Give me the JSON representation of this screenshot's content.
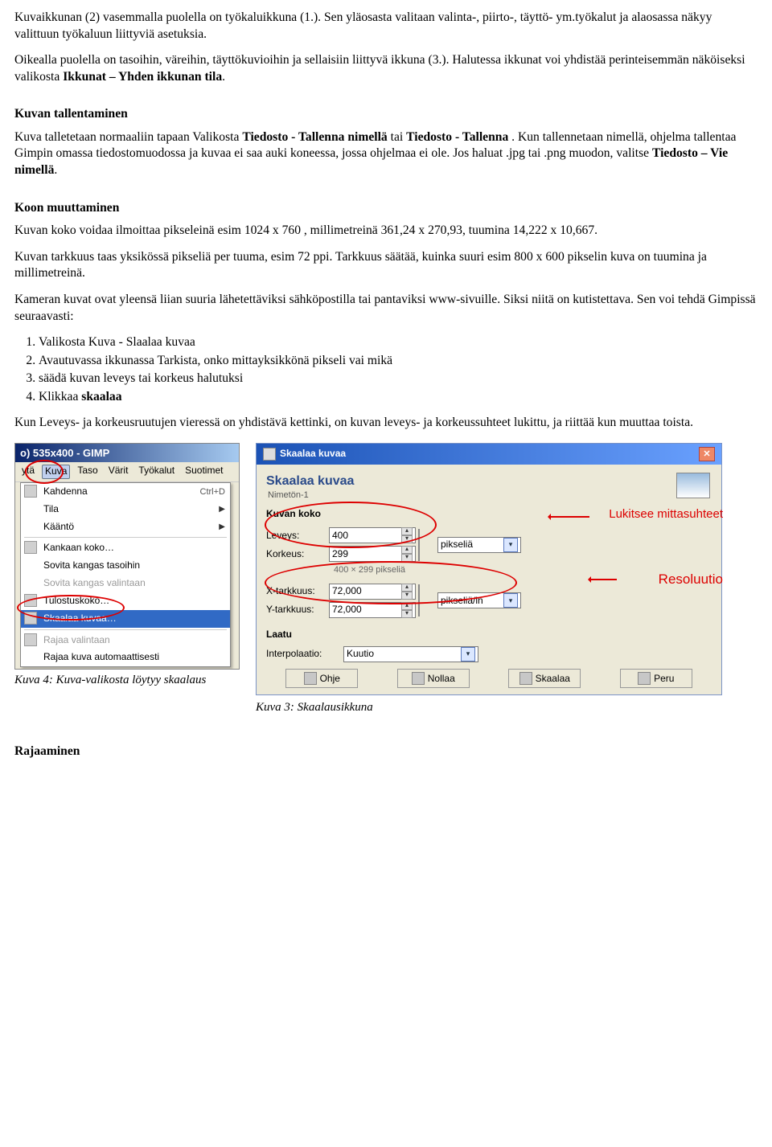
{
  "p1a": "Kuvaikkunan (2) vasemmalla puolella on työkaluikkuna (1.). Sen yläosasta valitaan valinta-, piirto-, täyttö- ym.työkalut ja alaosassa näkyy valittuun työkaluun liittyviä asetuksia.",
  "p1b_pre": "Oikealla puolella on tasoihin, väreihin, täyttökuvioihin ja sellaisiin liittyvä ikkuna (3.). Halutessa ikkunat voi yhdistää perinteisemmän näköiseksi valikosta ",
  "p1b_strong": "Ikkunat – Yhden ikkunan tila",
  "s1_title": "Kuvan tallentaminen",
  "s1_p1_a": "Kuva talletetaan normaaliin tapaan Valikosta ",
  "s1_p1_b": "Tiedosto - Tallenna nimellä",
  "s1_p1_c": "  tai ",
  "s1_p1_d": "Tiedosto - Tallenna",
  "s1_p1_e": ". Kun tallennetaan nimellä, ohjelma tallentaa Gimpin omassa tiedostomuodossa ja kuvaa ei saa auki koneessa, jossa ohjelmaa ei ole. Jos haluat .jpg tai .png muodon, valitse ",
  "s1_p1_f": "Tiedosto – Vie nimellä",
  "s2_title": "Koon muuttaminen",
  "s2_p1": "Kuvan koko voidaa ilmoittaa pikseleinä esim 1024 x 760 , millimetreinä 361,24 x 270,93, tuumina 14,222 x 10,667.",
  "s2_p2": "Kuvan tarkkuus taas yksikössä pikseliä per tuuma, esim 72 ppi. Tarkkuus säätää, kuinka suuri esim 800 x 600 pikselin kuva on tuumina ja millimetreinä.",
  "s2_p3": "Kameran kuvat ovat yleensä liian suuria lähetettäviksi sähköpostilla tai pantaviksi www-sivuille. Siksi niitä on kutistettava. Sen voi tehdä Gimpissä seuraavasti:",
  "ol": {
    "i1": "Valikosta Kuva - Slaalaa kuvaa",
    "i2": "Avautuvassa ikkunassa Tarkista, onko mittayksikkönä pikseli vai mikä",
    "i3": "säädä kuvan leveys tai korkeus halutuksi",
    "i4_a": "Klikkaa ",
    "i4_b": "skaalaa"
  },
  "s2_p4": "Kun Leveys- ja korkeusruutujen vieressä on yhdistävä kettinki, on kuvan leveys- ja korkeussuhteet lukittu, ja riittää kun muuttaa toista.",
  "fig_left_caption": "Kuva 4: Kuva-valikosta löytyy skaalaus",
  "fig_right_caption": "Kuva 3: Skaalausikkuna",
  "gimp": {
    "title": "o) 535x400 - GIMP",
    "menu": {
      "m1": "ytä",
      "m2": "Kuva",
      "m3": "Taso",
      "m4": "Värit",
      "m5": "Työkalut",
      "m6": "Suotimet"
    },
    "items": {
      "kahdenna": "Kahdenna",
      "kahdenna_sc": "Ctrl+D",
      "tila": "Tila",
      "kaanto": "Kääntö",
      "kankaan": "Kankaan koko…",
      "sovita1": "Sovita kangas tasoihin",
      "sovita2": "Sovita kangas valintaan",
      "tulostus": "Tulostuskoko…",
      "skaalaa": "Skaalaa kuvaa…",
      "rajaa1": "Rajaa valintaan",
      "rajaa2": "Rajaa kuva automaattisesti"
    }
  },
  "dlg": {
    "title": "Skaalaa kuvaa",
    "head": "Skaalaa kuvaa",
    "sub": "Nimetön-1",
    "sec1": "Kuvan koko",
    "leveys": "Leveys:",
    "leveys_v": "400",
    "korkeus": "Korkeus:",
    "korkeus_v": "299",
    "unit1": "pikseliä",
    "subtxt": "400 × 299 pikseliä",
    "xtark": "X-tarkkuus:",
    "xtark_v": "72,000",
    "ytark": "Y-tarkkuus:",
    "ytark_v": "72,000",
    "unit2": "pikseliä/in",
    "sec2": "Laatu",
    "interp": "Interpolaatio:",
    "interp_v": "Kuutio",
    "btn_ohje": "Ohje",
    "btn_nollaa": "Nollaa",
    "btn_skaalaa": "Skaalaa",
    "btn_peru": "Peru",
    "anno1": "Lukitsee mittasuhteet",
    "anno2": "Resoluutio"
  },
  "s3_title": "Rajaaminen"
}
